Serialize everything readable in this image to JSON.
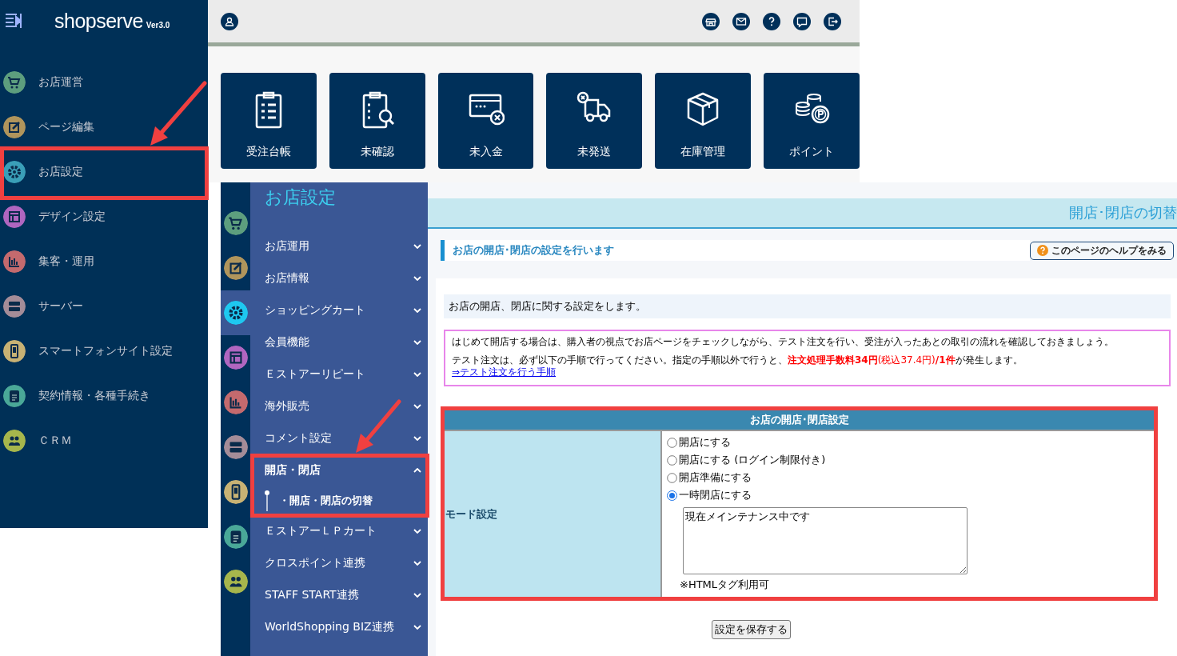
{
  "sidebar": {
    "logo": "shopserve",
    "version": "Ver3.0",
    "items": [
      {
        "label": "お店運営",
        "color": "#5d9e7e"
      },
      {
        "label": "ページ編集",
        "color": "#b0955c"
      },
      {
        "label": "お店設定",
        "color": "#3a9fb8"
      },
      {
        "label": "デザイン設定",
        "color": "#b066c0"
      },
      {
        "label": "集客・運用",
        "color": "#c46a6e"
      },
      {
        "label": "サーバー",
        "color": "#a48c98"
      },
      {
        "label": "スマートフォンサイト設定",
        "color": "#c8b274"
      },
      {
        "label": "契約情報・各種手続き",
        "color": "#4aa898"
      },
      {
        "label": "ＣＲＭ",
        "color": "#a6b64c"
      }
    ]
  },
  "tiles": [
    {
      "label": "受注台帳"
    },
    {
      "label": "未確認"
    },
    {
      "label": "未入金"
    },
    {
      "label": "未発送"
    },
    {
      "label": "在庫管理"
    },
    {
      "label": "ポイント"
    }
  ],
  "rail": [
    {
      "color": "#5d9e7e",
      "selected": false
    },
    {
      "color": "#b0955c",
      "selected": false
    },
    {
      "color": "#1ec8f0",
      "selected": true
    },
    {
      "color": "#b066c0",
      "selected": false
    },
    {
      "color": "#c46a6e",
      "selected": false
    },
    {
      "color": "#a48c98",
      "selected": false
    },
    {
      "color": "#c8b274",
      "selected": false
    },
    {
      "color": "#4aa898",
      "selected": false
    },
    {
      "color": "#a6b64c",
      "selected": false
    }
  ],
  "submenu": {
    "title": "お店設定",
    "items": [
      {
        "label": "お店運用",
        "expanded": false
      },
      {
        "label": "お店情報",
        "expanded": false
      },
      {
        "label": "ショッピングカート",
        "expanded": false
      },
      {
        "label": "会員機能",
        "expanded": false
      },
      {
        "label": "Ｅストアーリピート",
        "expanded": false
      },
      {
        "label": "海外販売",
        "expanded": false
      },
      {
        "label": "コメント設定",
        "expanded": false
      },
      {
        "label": "開店・閉店",
        "expanded": true,
        "children": [
          {
            "label": "・開店・閉店の切替"
          }
        ]
      },
      {
        "label": "ＥストアーＬＰカート",
        "expanded": false
      },
      {
        "label": "クロスポイント連携",
        "expanded": false
      },
      {
        "label": "STAFF START連携",
        "expanded": false
      },
      {
        "label": "WorldShopping BIZ連携",
        "expanded": false
      }
    ]
  },
  "page": {
    "title": "開店･閉店の切替",
    "heading": "お店の開店･閉店の設定を行います",
    "help_button": "このページのヘルプをみる",
    "description": "お店の開店、閉店に関する設定をします。",
    "notice": {
      "line1": "はじめて開店する場合は、購入者の視点でお店ページをチェックしながら、テスト注文を行い、受注が入ったあとの取引の流れを確認しておきましょう。",
      "line2_before": "テスト注文は、必ず以下の手順で行ってください。指定の手順以外で行うと、",
      "line2_fee": "**注文処理手数料34円**(税込37.4円)**/1件**",
      "line2_after": "が発生します。",
      "link": "⇒テスト注文を行う手順"
    },
    "settings": {
      "title": "お店の開店･閉店設定",
      "row_label": "モード設定",
      "options": [
        {
          "label": "開店にする",
          "selected": false
        },
        {
          "label": "開店にする (ログイン制限付き)",
          "selected": false
        },
        {
          "label": "開店準備にする",
          "selected": false
        },
        {
          "label": "一時閉店にする",
          "selected": true
        }
      ],
      "message": "現在メインテナンス中です",
      "note": "※HTMLタグ利用可"
    },
    "save_button": "設定を保存する"
  }
}
